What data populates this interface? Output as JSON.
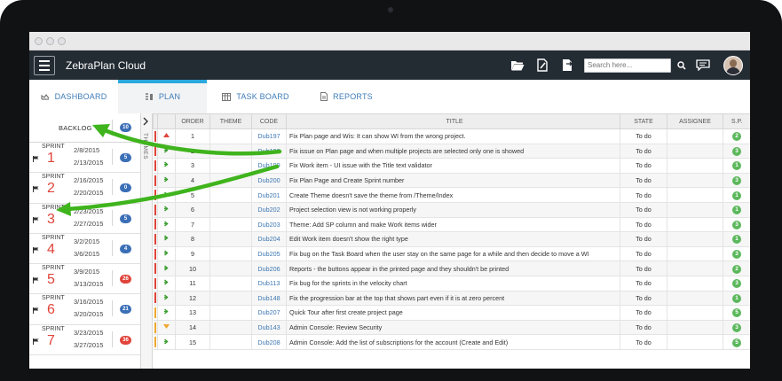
{
  "app": {
    "title": "ZebraPlan Cloud"
  },
  "search": {
    "placeholder": "Search here..."
  },
  "tabs": [
    {
      "label": "DASHBOARD",
      "icon": "dashboard-icon"
    },
    {
      "label": "PLAN",
      "icon": "plan-icon",
      "active": true
    },
    {
      "label": "TASK BOARD",
      "icon": "taskboard-icon"
    },
    {
      "label": "REPORTS",
      "icon": "reports-icon"
    }
  ],
  "backlog": {
    "label": "BACKLOG",
    "count": "10"
  },
  "sprints": [
    {
      "label": "SPRINT",
      "number": "1",
      "start": "2/8/2015",
      "end": "2/13/2015",
      "count": "5",
      "badge_color": "#3b6fb6"
    },
    {
      "label": "SPRINT",
      "number": "2",
      "start": "2/16/2015",
      "end": "2/20/2015",
      "count": "0",
      "badge_color": "#3b6fb6"
    },
    {
      "label": "SPRINT",
      "number": "3",
      "start": "2/23/2015",
      "end": "2/27/2015",
      "count": "5",
      "badge_color": "#3b6fb6"
    },
    {
      "label": "SPRINT",
      "number": "4",
      "start": "3/2/2015",
      "end": "3/6/2015",
      "count": "4",
      "badge_color": "#3b6fb6"
    },
    {
      "label": "SPRINT",
      "number": "5",
      "start": "3/9/2015",
      "end": "3/13/2015",
      "count": "26",
      "badge_color": "#e0443a"
    },
    {
      "label": "SPRINT",
      "number": "6",
      "start": "3/16/2015",
      "end": "3/20/2015",
      "count": "21",
      "badge_color": "#3b6fb6"
    },
    {
      "label": "SPRINT",
      "number": "7",
      "start": "3/23/2015",
      "end": "3/27/2015",
      "count": "36",
      "badge_color": "#e0443a"
    }
  ],
  "themes_label": "THEMES",
  "columns": {
    "order": "ORDER",
    "theme": "THEME",
    "code": "CODE",
    "title": "TITLE",
    "state": "STATE",
    "assignee": "ASSIGNEE",
    "sp": "S.P."
  },
  "rows": [
    {
      "bar": "#e0443a",
      "arrow": "up",
      "order": "1",
      "code": "Dub197",
      "title": "Fix Plan page and Wis: It can show WI from the wrong project.",
      "state": "To do",
      "sp": "2"
    },
    {
      "bar": "#e0443a",
      "arrow": "right",
      "order": "2",
      "code": "Dub198",
      "title": "Fix issue on Plan page and when multiple projects are selected only one is showed",
      "state": "To do",
      "sp": "3"
    },
    {
      "bar": "#e0443a",
      "arrow": "right",
      "order": "3",
      "code": "Dub199",
      "title": "Fix Work item - UI issue with the Title text validator",
      "state": "To do",
      "sp": "1"
    },
    {
      "bar": "#e0443a",
      "arrow": "right",
      "order": "4",
      "code": "Dub200",
      "title": "Fix Plan Page and Create Sprint number",
      "state": "To do",
      "sp": "3"
    },
    {
      "bar": "#e0443a",
      "arrow": "right",
      "order": "5",
      "code": "Dub201",
      "title": "Create Theme doesn't save the theme from /Theme/Index",
      "state": "To do",
      "sp": "1"
    },
    {
      "bar": "#e0443a",
      "arrow": "right",
      "order": "6",
      "code": "Dub202",
      "title": "Project selection view is not working properly",
      "state": "To do",
      "sp": "1"
    },
    {
      "bar": "#e0443a",
      "arrow": "right",
      "order": "7",
      "code": "Dub203",
      "title": "Theme: Add SP column and make Work items wider",
      "state": "To do",
      "sp": "3"
    },
    {
      "bar": "#e0443a",
      "arrow": "right",
      "order": "8",
      "code": "Dub204",
      "title": "Edit Work item doesn't show the right type",
      "state": "To do",
      "sp": "1"
    },
    {
      "bar": "#e0443a",
      "arrow": "right",
      "order": "9",
      "code": "Dub205",
      "title": "Fix bug on the Task Board when the user stay on the same page for a while and then decide to move a WI",
      "state": "To do",
      "sp": "3"
    },
    {
      "bar": "#e0443a",
      "arrow": "right",
      "order": "10",
      "code": "Dub206",
      "title": "Reports - the buttons appear in the printed page and they shouldn't be printed",
      "state": "To do",
      "sp": "2"
    },
    {
      "bar": "#e0443a",
      "arrow": "right",
      "order": "11",
      "code": "Dub113",
      "title": "Fix bug for the sprints in the velocity chart",
      "state": "To do",
      "sp": "3"
    },
    {
      "bar": "#e0443a",
      "arrow": "right",
      "order": "12",
      "code": "Dub148",
      "title": "Fix the progression bar at the top that shows part even if it is at zero percent",
      "state": "To do",
      "sp": "1"
    },
    {
      "bar": "#f0a830",
      "arrow": "right",
      "order": "13",
      "code": "Dub207",
      "title": "Quick Tour after first create project page",
      "state": "To do",
      "sp": "5"
    },
    {
      "bar": "#f0a830",
      "arrow": "down",
      "order": "14",
      "code": "Dub143",
      "title": "Admin Console: Review Security",
      "state": "To do",
      "sp": "3"
    },
    {
      "bar": "#f0a830",
      "arrow": "right",
      "order": "15",
      "code": "Dub208",
      "title": "Admin Console: Add the list of subscriptions for the account (Create and Edit)",
      "state": "To do",
      "sp": "5"
    }
  ]
}
